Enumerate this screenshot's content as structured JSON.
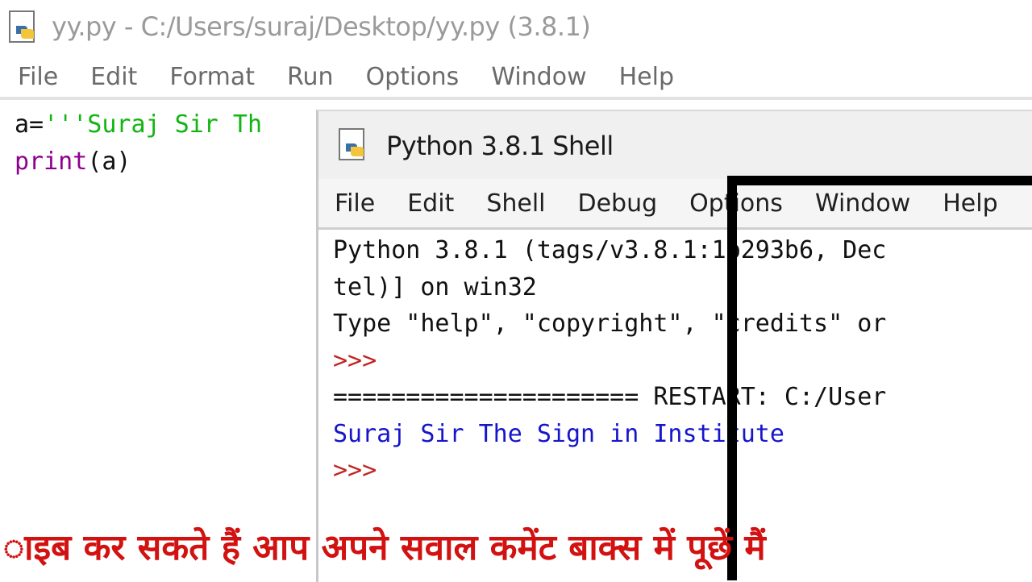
{
  "editor": {
    "title": "yy.py - C:/Users/suraj/Desktop/yy.py (3.8.1)",
    "menu": [
      "File",
      "Edit",
      "Format",
      "Run",
      "Options",
      "Window",
      "Help"
    ],
    "code": {
      "line1_var": "a=",
      "line1_str": "'''Suraj Sir Th",
      "line2_func": "print",
      "line2_args": "(a)"
    }
  },
  "shell": {
    "title": "Python 3.8.1 Shell",
    "menu": [
      "File",
      "Edit",
      "Shell",
      "Debug",
      "Options",
      "Window",
      "Help"
    ],
    "lines": {
      "l1": "Python 3.8.1 (tags/v3.8.1:1b293b6, Dec",
      "l2": "tel)] on win32",
      "l3": "Type \"help\", \"copyright\", \"credits\" or",
      "prompt1": ">>>",
      "restart": "===================== RESTART: C:/User",
      "output": "Suraj Sir The Sign in Institute",
      "prompt2": ">>>"
    }
  },
  "caption": {
    "text": "ाइब कर सकते हैं आप अपने सवाल कमेंट बाक्स में पूछें मैं",
    "color": "#d21111"
  },
  "colors": {
    "string_green": "#11b511",
    "builtin_purple": "#900090",
    "prompt_red": "#c22222",
    "output_blue": "#1515cc"
  }
}
